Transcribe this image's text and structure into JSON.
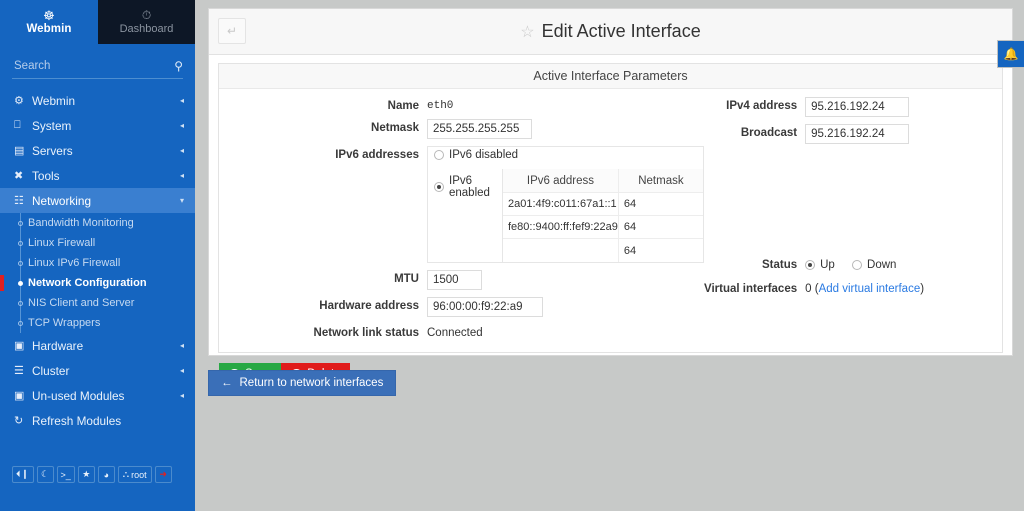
{
  "sidebar": {
    "brand": {
      "label": "Webmin",
      "icon": "webmin-logo-icon"
    },
    "dashboard_tab": {
      "label": "Dashboard",
      "icon": "gauge-icon"
    },
    "search": {
      "placeholder": "Search",
      "value": "",
      "icon": "search-icon"
    },
    "groups": [
      {
        "label": "Webmin",
        "icon": "gear-icon",
        "caret": "◂"
      },
      {
        "label": "System",
        "icon": "monitor-icon",
        "caret": "◂"
      },
      {
        "label": "Servers",
        "icon": "server-icon",
        "caret": "◂"
      },
      {
        "label": "Tools",
        "icon": "wrench-icon",
        "caret": "◂"
      },
      {
        "label": "Networking",
        "icon": "network-icon",
        "caret": "▾"
      }
    ],
    "networking_children": [
      {
        "label": "Bandwidth Monitoring"
      },
      {
        "label": "Linux Firewall"
      },
      {
        "label": "Linux IPv6 Firewall"
      },
      {
        "label": "Network Configuration"
      },
      {
        "label": "NIS Client and Server"
      },
      {
        "label": "TCP Wrappers"
      }
    ],
    "selected_child": "Network Configuration",
    "groups_after": [
      {
        "label": "Hardware",
        "icon": "chip-icon",
        "caret": "◂"
      },
      {
        "label": "Cluster",
        "icon": "layers-icon",
        "caret": "◂"
      },
      {
        "label": "Un-used Modules",
        "icon": "puzzle-icon",
        "caret": "◂"
      },
      {
        "label": "Refresh Modules",
        "icon": "refresh-icon",
        "caret": ""
      }
    ],
    "footer_buttons": [
      {
        "name": "collapse-sidebar",
        "glyph": "⏴┃"
      },
      {
        "name": "theme-toggle",
        "glyph": "☾"
      },
      {
        "name": "terminal",
        "glyph": ">_"
      },
      {
        "name": "favorites",
        "glyph": "★"
      },
      {
        "name": "theme-palette",
        "glyph": "◕"
      },
      {
        "name": "user",
        "glyph": "⛬",
        "label": "root"
      },
      {
        "name": "logout",
        "glyph": "➜"
      }
    ]
  },
  "header": {
    "back_glyph": "↵",
    "star_glyph": "☆",
    "title": "Edit Active Interface"
  },
  "notification": {
    "glyph": "ὑ4",
    "bell": "▲"
  },
  "panel": {
    "title": "Active Interface Parameters",
    "fields": {
      "name_label": "Name",
      "name_value": "eth0",
      "netmask_label": "Netmask",
      "netmask_value": "255.255.255.255",
      "ipv6_label": "IPv6 addresses",
      "ipv6_disabled_label": "IPv6 disabled",
      "ipv6_enabled_label": "IPv6 enabled",
      "ipv6_selected": "enabled",
      "mtu_label": "MTU",
      "mtu_value": "1500",
      "hwaddr_label": "Hardware address",
      "hwaddr_value": "96:00:00:f9:22:a9",
      "linkstatus_label": "Network link status",
      "linkstatus_value": "Connected",
      "ipv4_label": "IPv4 address",
      "ipv4_value": "95.216.192.24",
      "broadcast_label": "Broadcast",
      "broadcast_value": "95.216.192.24",
      "status_label": "Status",
      "status_up_label": "Up",
      "status_down_label": "Down",
      "status_selected": "Up",
      "virtual_label": "Virtual interfaces",
      "virtual_count": "0",
      "virtual_link_open": "(",
      "virtual_link": "Add virtual interface",
      "virtual_link_close": ")"
    },
    "ipv6_table": {
      "columns": [
        "IPv6 address",
        "Netmask"
      ],
      "rows": [
        {
          "address": "2a01:4f9:c011:67a1::1",
          "netmask": "64"
        },
        {
          "address": "fe80::9400:ff:fef9:22a9",
          "netmask": "64"
        },
        {
          "address": "",
          "netmask": "64"
        }
      ]
    },
    "buttons": {
      "save_label": "Save",
      "save_icon": "✓",
      "delete_label": "Delete",
      "delete_icon": "✕"
    }
  },
  "return_button": {
    "arrow": "←",
    "label": "Return to network interfaces"
  },
  "colors": {
    "sidebar": "#1565c0",
    "dashboard_tab": "#0d1726",
    "page_bg": "#c7c9c8",
    "save_green": "#27a844",
    "delete_red": "#e01b1b",
    "return_blue": "#3a6fb8",
    "link_blue": "#2a7ae2",
    "active_marker_red": "#e02020"
  }
}
